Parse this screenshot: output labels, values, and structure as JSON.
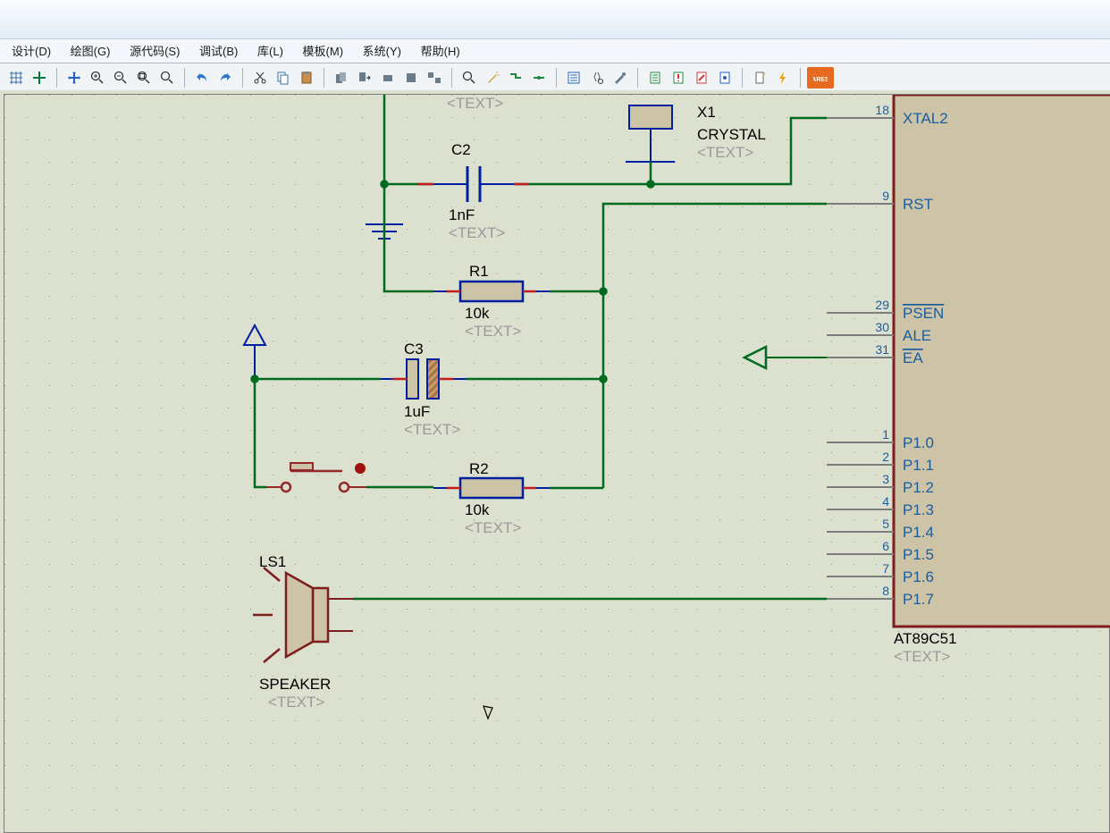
{
  "menu": {
    "design": "设计(D)",
    "draw": "绘图(G)",
    "source": "源代码(S)",
    "debug": "调试(B)",
    "lib": "库(L)",
    "template": "模板(M)",
    "system": "系统(Y)",
    "help": "帮助(H)"
  },
  "chip": {
    "part": "AT89C51",
    "template": "<TEXT>",
    "pins": [
      {
        "num": "18",
        "name": "XTAL2"
      },
      {
        "num": "9",
        "name": "RST"
      },
      {
        "num": "29",
        "name": "PSEN",
        "over": true
      },
      {
        "num": "30",
        "name": "ALE"
      },
      {
        "num": "31",
        "name": "EA",
        "over": true
      },
      {
        "num": "1",
        "name": "P1.0"
      },
      {
        "num": "2",
        "name": "P1.1"
      },
      {
        "num": "3",
        "name": "P1.2"
      },
      {
        "num": "4",
        "name": "P1.3"
      },
      {
        "num": "5",
        "name": "P1.4"
      },
      {
        "num": "6",
        "name": "P1.5"
      },
      {
        "num": "7",
        "name": "P1.6"
      },
      {
        "num": "8",
        "name": "P1.7"
      }
    ]
  },
  "components": {
    "X1": {
      "name": "X1",
      "value": "CRYSTAL",
      "tmpl": "<TEXT>",
      "tmpl2": "<TEXT>"
    },
    "C2": {
      "name": "C2",
      "value": "1nF",
      "tmpl": "<TEXT>"
    },
    "C3": {
      "name": "C3",
      "value": "1uF",
      "tmpl": "<TEXT>"
    },
    "R1": {
      "name": "R1",
      "value": "10k",
      "tmpl": "<TEXT>"
    },
    "R2": {
      "name": "R2",
      "value": "10k",
      "tmpl": "<TEXT>"
    },
    "LS1": {
      "name": "LS1",
      "value": "SPEAKER",
      "tmpl": "<TEXT>"
    }
  }
}
